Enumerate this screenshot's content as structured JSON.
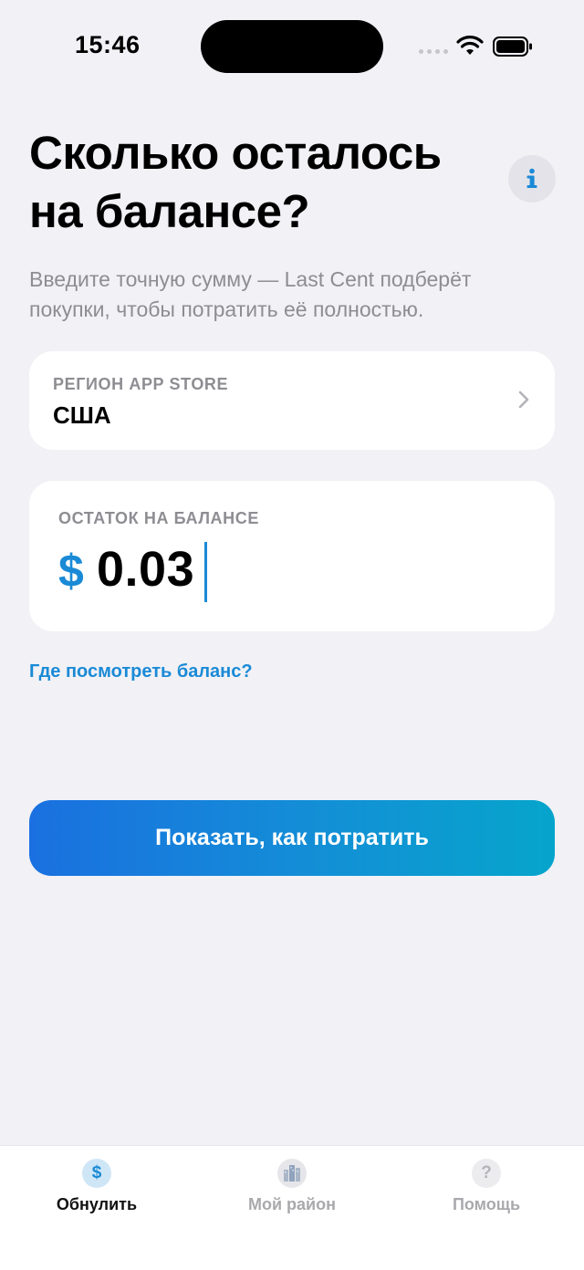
{
  "status_bar": {
    "time": "15:46"
  },
  "header": {
    "title": "Сколько осталось на балансе?",
    "subtitle": "Введите точную сумму — Last Cent подберёт покупки, чтобы потратить её полностью."
  },
  "region": {
    "label": "РЕГИОН APP STORE",
    "value": "США"
  },
  "balance": {
    "label": "ОСТАТОК НА БАЛАНСЕ",
    "currency_symbol": "$",
    "amount": "0.03"
  },
  "links": {
    "where_to_see_balance": "Где посмотреть баланс?"
  },
  "actions": {
    "show_how_to_spend": "Показать, как потратить"
  },
  "tab_bar": {
    "items": [
      {
        "label": "Обнулить",
        "icon": "dollar-icon",
        "glyph": "$",
        "active": true
      },
      {
        "label": "Мой район",
        "icon": "city-icon",
        "active": false
      },
      {
        "label": "Помощь",
        "icon": "question-icon",
        "glyph": "?",
        "active": false
      }
    ]
  },
  "colors": {
    "accent": "#1a8ad6",
    "background": "#f1f1f6",
    "cta_start": "#1a70e0",
    "cta_end": "#06a5cc"
  }
}
